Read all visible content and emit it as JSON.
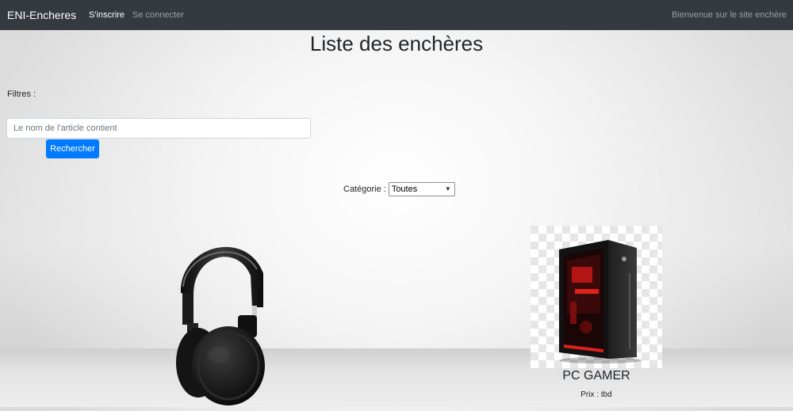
{
  "navbar": {
    "brand": "ENI-Encheres",
    "links": [
      {
        "label": "S'inscrire"
      },
      {
        "label": "Se connecter"
      }
    ],
    "welcome": "Bienvenue sur le site enchère"
  },
  "main": {
    "title": "Liste des enchères",
    "filters_label": "Filtres :",
    "search": {
      "placeholder": "Le nom de l'article contient",
      "value": "",
      "button_label": "Rechercher"
    },
    "category": {
      "label": "Catégorie :",
      "selected": "Toutes"
    }
  },
  "items": [
    {
      "image": "headphones-image",
      "title": "",
      "price": ""
    },
    {
      "image": "pc-tower-image",
      "title": "PC GAMER",
      "price": "Prix : tbd"
    }
  ],
  "colors": {
    "navbar_bg": "#343a40",
    "primary": "#007bff",
    "pc_accent": "#e0201a"
  }
}
